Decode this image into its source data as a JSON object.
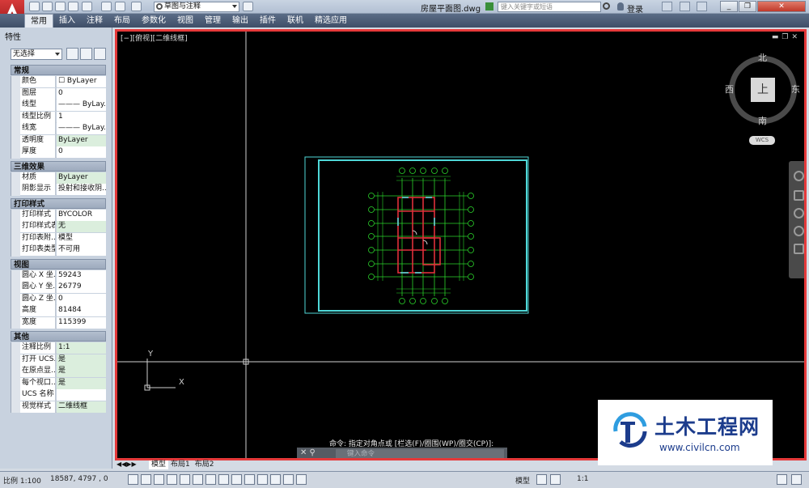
{
  "titlebar": {
    "workspace": "草图与注释",
    "doc_title": "房屋平面图.dwg",
    "search_placeholder": "键入关键字或短语",
    "login": "登录"
  },
  "ribbon": {
    "tabs": [
      "常用",
      "插入",
      "注释",
      "布局",
      "参数化",
      "视图",
      "管理",
      "输出",
      "插件",
      "联机",
      "精选应用"
    ],
    "active_tab": "常用"
  },
  "palette": {
    "title": "特性",
    "selection": "无选择",
    "sections": [
      {
        "title": "常规",
        "rows": [
          {
            "k": "颜色",
            "v": "☐ ByLayer",
            "hl": false
          },
          {
            "k": "图层",
            "v": "0",
            "hl": false
          },
          {
            "k": "线型",
            "v": "——— ByLay...",
            "hl": false
          },
          {
            "k": "线型比例",
            "v": "1",
            "hl": false
          },
          {
            "k": "线宽",
            "v": "——— ByLay...",
            "hl": false
          },
          {
            "k": "透明度",
            "v": "ByLayer",
            "hl": true
          },
          {
            "k": "厚度",
            "v": "0",
            "hl": false
          }
        ]
      },
      {
        "title": "三维效果",
        "rows": [
          {
            "k": "材质",
            "v": "ByLayer",
            "hl": true
          },
          {
            "k": "阴影显示",
            "v": "投射和接收阴...",
            "hl": false
          }
        ]
      },
      {
        "title": "打印样式",
        "rows": [
          {
            "k": "打印样式",
            "v": "BYCOLOR",
            "hl": false
          },
          {
            "k": "打印样式表",
            "v": "无",
            "hl": true
          },
          {
            "k": "打印表附...",
            "v": "模型",
            "hl": false
          },
          {
            "k": "打印表类型",
            "v": "不可用",
            "hl": false
          }
        ]
      },
      {
        "title": "视图",
        "rows": [
          {
            "k": "圆心 X 坐...",
            "v": "59243",
            "hl": false
          },
          {
            "k": "圆心 Y 坐...",
            "v": "26779",
            "hl": false
          },
          {
            "k": "圆心 Z 坐...",
            "v": "0",
            "hl": false
          },
          {
            "k": "高度",
            "v": "81484",
            "hl": false
          },
          {
            "k": "宽度",
            "v": "115399",
            "hl": false
          }
        ]
      },
      {
        "title": "其他",
        "rows": [
          {
            "k": "注释比例",
            "v": "1:1",
            "hl": true
          },
          {
            "k": "打开 UCS...",
            "v": "是",
            "hl": true
          },
          {
            "k": "在原点显...",
            "v": "是",
            "hl": true
          },
          {
            "k": "每个视口...",
            "v": "是",
            "hl": true
          },
          {
            "k": "UCS 名称",
            "v": "",
            "hl": false
          },
          {
            "k": "视觉样式",
            "v": "二维线框",
            "hl": true
          }
        ]
      }
    ]
  },
  "canvas": {
    "viewport_label": "[−][俯视][二维线框]",
    "compass": {
      "north": "北",
      "south": "南",
      "east": "东",
      "west": "西",
      "cube": "上"
    },
    "ucs": "WCS",
    "axis_x": "X",
    "axis_y": "Y",
    "command_history": "命令: 指定对角点或 [栏选(F)/圈围(WP)/圈交(CP)]:",
    "command_placeholder": "键入命令"
  },
  "layout_tabs": {
    "tabs": [
      "模型",
      "布局1",
      "布局2"
    ],
    "active": "模型"
  },
  "statusbar": {
    "scale": "比例 1:100",
    "coords": "18587, 4797 , 0",
    "model": "模型",
    "zoom": "1:1"
  },
  "watermark": {
    "title": "土木工程网",
    "url": "www.civilcn.com"
  },
  "colors": {
    "accent_red": "#e5393a",
    "canvas_bg": "#000000",
    "cyan": "#4fd8d8",
    "green": "#2bd62b",
    "red_wall": "#e0303a"
  }
}
